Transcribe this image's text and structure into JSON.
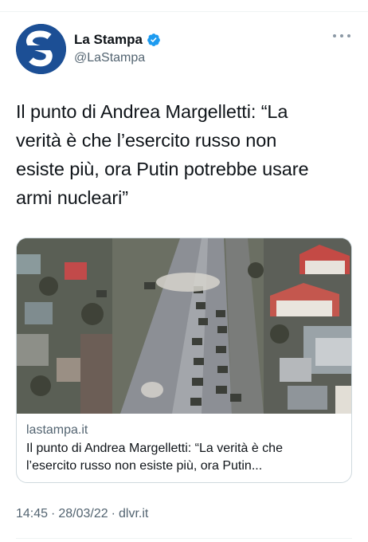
{
  "account": {
    "display_name": "La Stampa",
    "handle": "@LaStampa",
    "verified": true,
    "avatar_letter": "S",
    "avatar_color": "#1c4f95"
  },
  "tweet": {
    "line1": "Il punto di Andrea Margelletti: “La",
    "line2": "verità è che l’esercito russo non",
    "line3": "esiste più, ora Putin potrebbe usare",
    "line4": "armi nucleari”"
  },
  "link_card": {
    "domain": "lastampa.it",
    "title_line1": "Il punto di Andrea Margelletti: “La verità è che",
    "title_line2": "l’esercito russo non esiste più, ora Putin...",
    "image_description_icon": "photo"
  },
  "meta": {
    "time": "14:45",
    "date": "28/03/22",
    "source": "dlvr.it",
    "separator": "·"
  },
  "colors": {
    "verified": "#1d9bf0",
    "secondary_text": "#536471",
    "border": "#cfd9de"
  }
}
